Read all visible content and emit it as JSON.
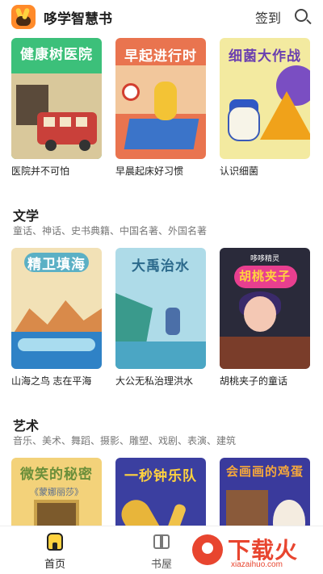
{
  "header": {
    "app_title": "哆学智慧书",
    "signin_label": "签到",
    "search_icon": "search-icon"
  },
  "row1": [
    {
      "cover_title": "健康树医院",
      "caption": "医院并不可怕"
    },
    {
      "cover_title": "早起进行时",
      "caption": "早晨起床好习惯"
    },
    {
      "cover_title": "细菌大作战",
      "caption": "认识细菌"
    }
  ],
  "literature": {
    "title": "文学",
    "subtitle": "童话、神话、史书典籍、中国名著、外国名著",
    "books": [
      {
        "cover_title": "精卫填海",
        "caption": "山海之鸟 志在平海"
      },
      {
        "cover_title": "大禹治水",
        "caption": "大公无私治理洪水"
      },
      {
        "cover_title": "胡桃夹子",
        "cover_small": "哆哆精灵",
        "caption": "胡桃夹子的童话"
      }
    ]
  },
  "art": {
    "title": "艺术",
    "subtitle": "音乐、美术、舞蹈、摄影、雕塑、戏剧、表演、建筑",
    "books": [
      {
        "cover_title": "微笑的秘密",
        "cover_sub": "《蒙娜丽莎》"
      },
      {
        "cover_title": "一秒钟乐队"
      },
      {
        "cover_title": "会画画的鸡蛋"
      }
    ]
  },
  "tabbar": {
    "home_label": "首页",
    "shelf_label": "书屋"
  },
  "watermark": {
    "text": "下载火",
    "url": "xiazaihuo.com"
  },
  "colors": {
    "accent": "#ff8a2a",
    "watermark": "#e8452f"
  }
}
